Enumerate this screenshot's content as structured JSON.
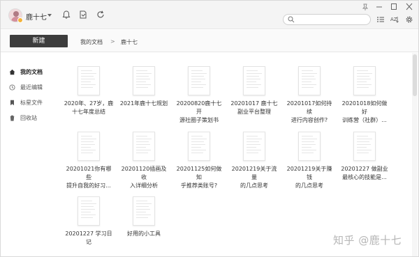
{
  "user": {
    "name": "鹿十七"
  },
  "search": {
    "placeholder": "",
    "value": ""
  },
  "toolbar": {
    "new_label": "新建"
  },
  "breadcrumb": {
    "root": "我的文档",
    "separator": ">",
    "current": "鹿十七"
  },
  "sidebar": {
    "items": [
      {
        "label": "我的文档",
        "icon": "home-icon"
      },
      {
        "label": "最近编辑",
        "icon": "clock-icon"
      },
      {
        "label": "标星文件",
        "icon": "bookmark-icon"
      },
      {
        "label": "回收站",
        "icon": "trash-icon"
      }
    ]
  },
  "documents": [
    {
      "line1": "2020年、27岁，鹿",
      "line2": "十七年度总结"
    },
    {
      "line1": "2021年鹿十七规划",
      "line2": ""
    },
    {
      "line1": "20200820鹿十七开",
      "line2": "源社圈子策划书"
    },
    {
      "line1": "20201017 鹿十七",
      "line2": "副业平台整理"
    },
    {
      "line1": "20201017如何持续",
      "line2": "进行内容创作?"
    },
    {
      "line1": "20201018如何做好",
      "line2": "训练营（社群）..."
    },
    {
      "line1": "20201021你有哪些",
      "line2": "提升自我的好习..."
    },
    {
      "line1": "20201120插画及收",
      "line2": "入详细分析"
    },
    {
      "line1": "20201125如何做知",
      "line2": "乎推荐类账号?"
    },
    {
      "line1": "20201219关于流量",
      "line2": "的几点思考"
    },
    {
      "line1": "20201219关于赚钱",
      "line2": "的几点思考"
    },
    {
      "line1": "20201227 做副业",
      "line2": "最核心的技能是..."
    },
    {
      "line1": "20201227 学习日",
      "line2": "记"
    },
    {
      "line1": "好用的小工具",
      "line2": ""
    }
  ],
  "watermark": "知乎 @鹿十七",
  "colors": {
    "new_button_bg": "#3d3d3d",
    "avatar_badge": "#f3b23a"
  }
}
